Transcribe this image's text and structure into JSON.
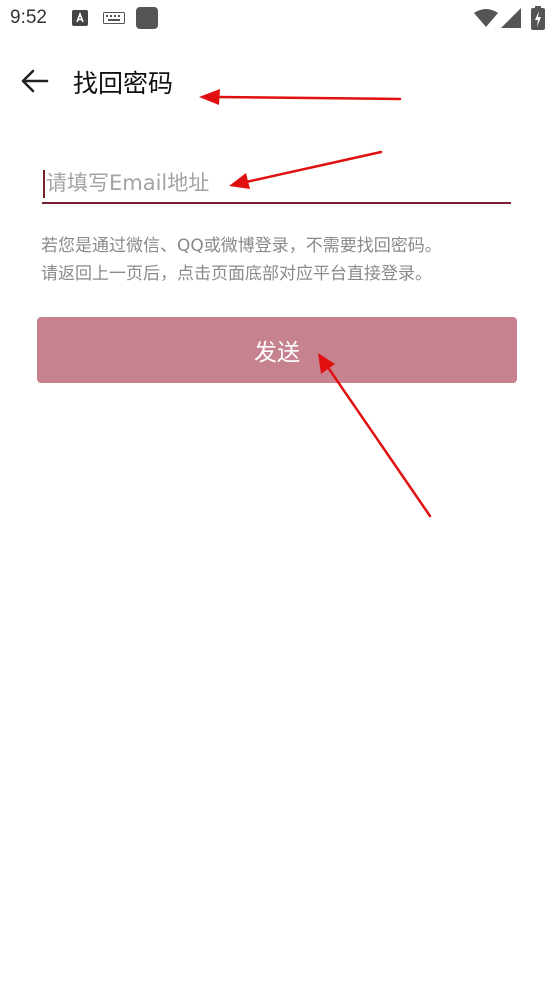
{
  "status_bar": {
    "time": "9:52",
    "icons": [
      "a11y-icon",
      "keyboard-icon",
      "app-icon",
      "wifi-icon",
      "signal-icon",
      "battery-icon"
    ]
  },
  "toolbar": {
    "back_icon": "arrow-left-icon",
    "title": "找回密码"
  },
  "form": {
    "email_placeholder": "请填写Email地址",
    "email_value": "",
    "hint_line1": "若您是通过微信、QQ或微博登录，不需要找回密码。",
    "hint_line2": "请返回上一页后，点击页面底部对应平台直接登录。",
    "send_label": "发送"
  },
  "colors": {
    "accent": "#7a1f30",
    "button": "#c6838f",
    "annotation": "#e01010"
  }
}
